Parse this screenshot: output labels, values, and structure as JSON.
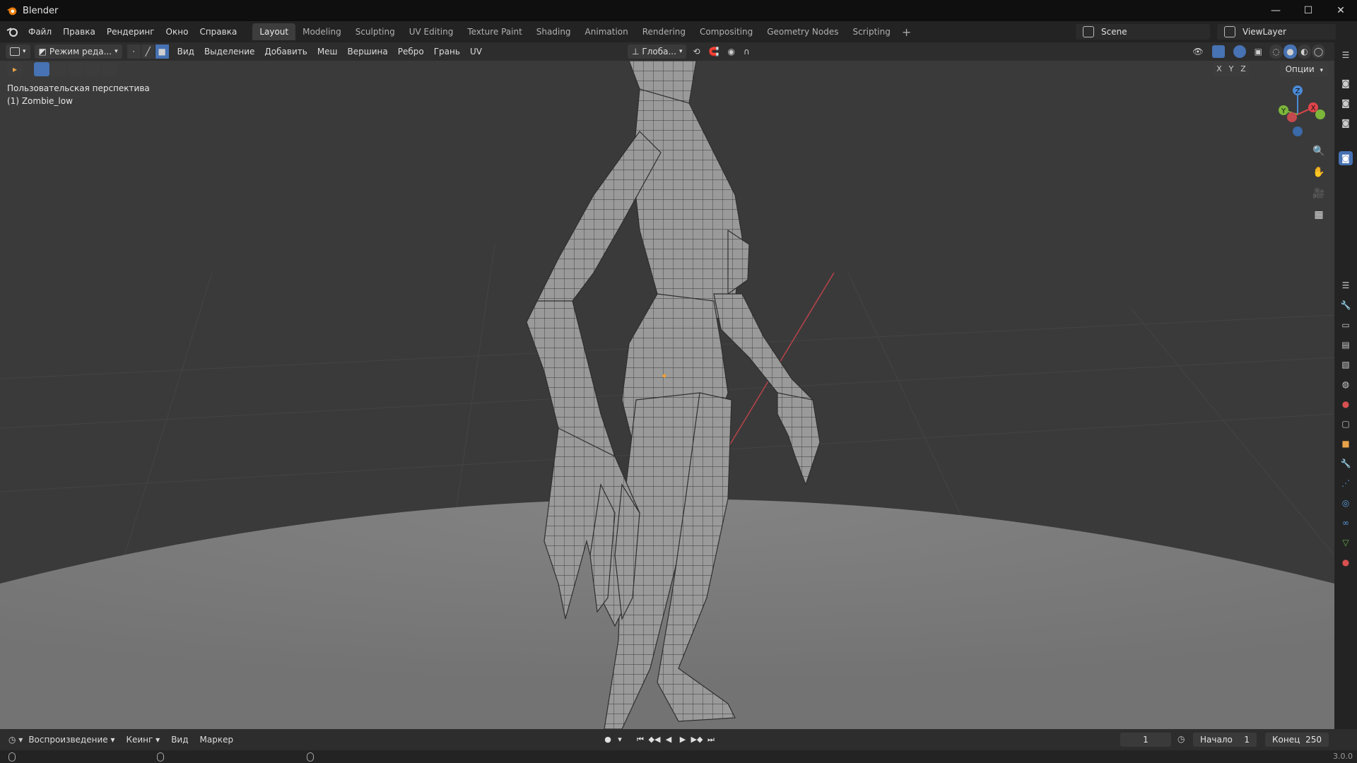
{
  "window": {
    "title": "Blender",
    "controls": [
      "—",
      "☐",
      "✕"
    ]
  },
  "menu": [
    "Файл",
    "Правка",
    "Рендеринг",
    "Окно",
    "Справка"
  ],
  "workspaces": {
    "tabs": [
      "Layout",
      "Modeling",
      "Sculpting",
      "UV Editing",
      "Texture Paint",
      "Shading",
      "Animation",
      "Rendering",
      "Compositing",
      "Geometry Nodes",
      "Scripting"
    ],
    "active": "Layout",
    "plus": "+"
  },
  "scene": {
    "name": "Scene",
    "view_layer": "ViewLayer"
  },
  "header": {
    "mode": "Режим реда...",
    "menus": [
      "Вид",
      "Выделение",
      "Добавить",
      "Меш",
      "Вершина",
      "Ребро",
      "Грань",
      "UV"
    ],
    "orientation": "Глоба...",
    "axes": [
      "X",
      "Y",
      "Z"
    ],
    "options": "Опции"
  },
  "viewport": {
    "view_name": "Пользовательская перспектива",
    "object_name": "(1) Zombie_low",
    "gizmo_labels": {
      "x": "X",
      "y": "Y",
      "z": "Z"
    },
    "colors": {
      "x": "#e0454a",
      "y": "#7cb63a",
      "z": "#4a8ad8",
      "ground": "#7a7a7a",
      "mesh": "#9c9c9c"
    }
  },
  "timeline": {
    "playback": "Воспроизведение",
    "keying": "Кеинг",
    "view": "Вид",
    "marker": "Маркер",
    "current_frame": "1",
    "start_label": "Начало",
    "start_value": "1",
    "end_label": "Конец",
    "end_value": "250"
  },
  "status": {
    "version": "3.0.0"
  },
  "icons": {
    "logo": "blender-logo-icon",
    "nav": [
      "zoom-icon",
      "hand-pan-icon",
      "camera-icon",
      "grid-ortho-icon"
    ],
    "properties": [
      "tool-icon",
      "render-icon",
      "output-icon",
      "view-layer-icon",
      "scene-icon",
      "world-icon",
      "collection-icon",
      "object-icon",
      "modifier-icon",
      "particles-icon",
      "physics-icon",
      "constraints-icon",
      "data-icon",
      "material-icon"
    ]
  }
}
